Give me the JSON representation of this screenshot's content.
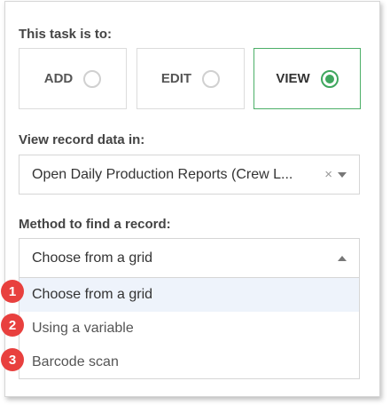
{
  "task": {
    "label": "This task is to:",
    "modes": [
      {
        "label": "ADD",
        "selected": false
      },
      {
        "label": "EDIT",
        "selected": false
      },
      {
        "label": "VIEW",
        "selected": true
      }
    ]
  },
  "record_data": {
    "label": "View record data in:",
    "value": "Open Daily Production Reports (Crew L...",
    "clear_symbol": "×"
  },
  "method": {
    "label": "Method to find a record:",
    "value": "Choose from a grid",
    "options": [
      {
        "label": "Choose from a grid",
        "marker": "1",
        "highlighted": true
      },
      {
        "label": "Using a variable",
        "marker": "2",
        "highlighted": false
      },
      {
        "label": "Barcode scan",
        "marker": "3",
        "highlighted": false
      }
    ]
  },
  "colors": {
    "accent_green": "#3fa75e",
    "marker_red": "#e8403e",
    "highlight": "#eef3fb"
  }
}
